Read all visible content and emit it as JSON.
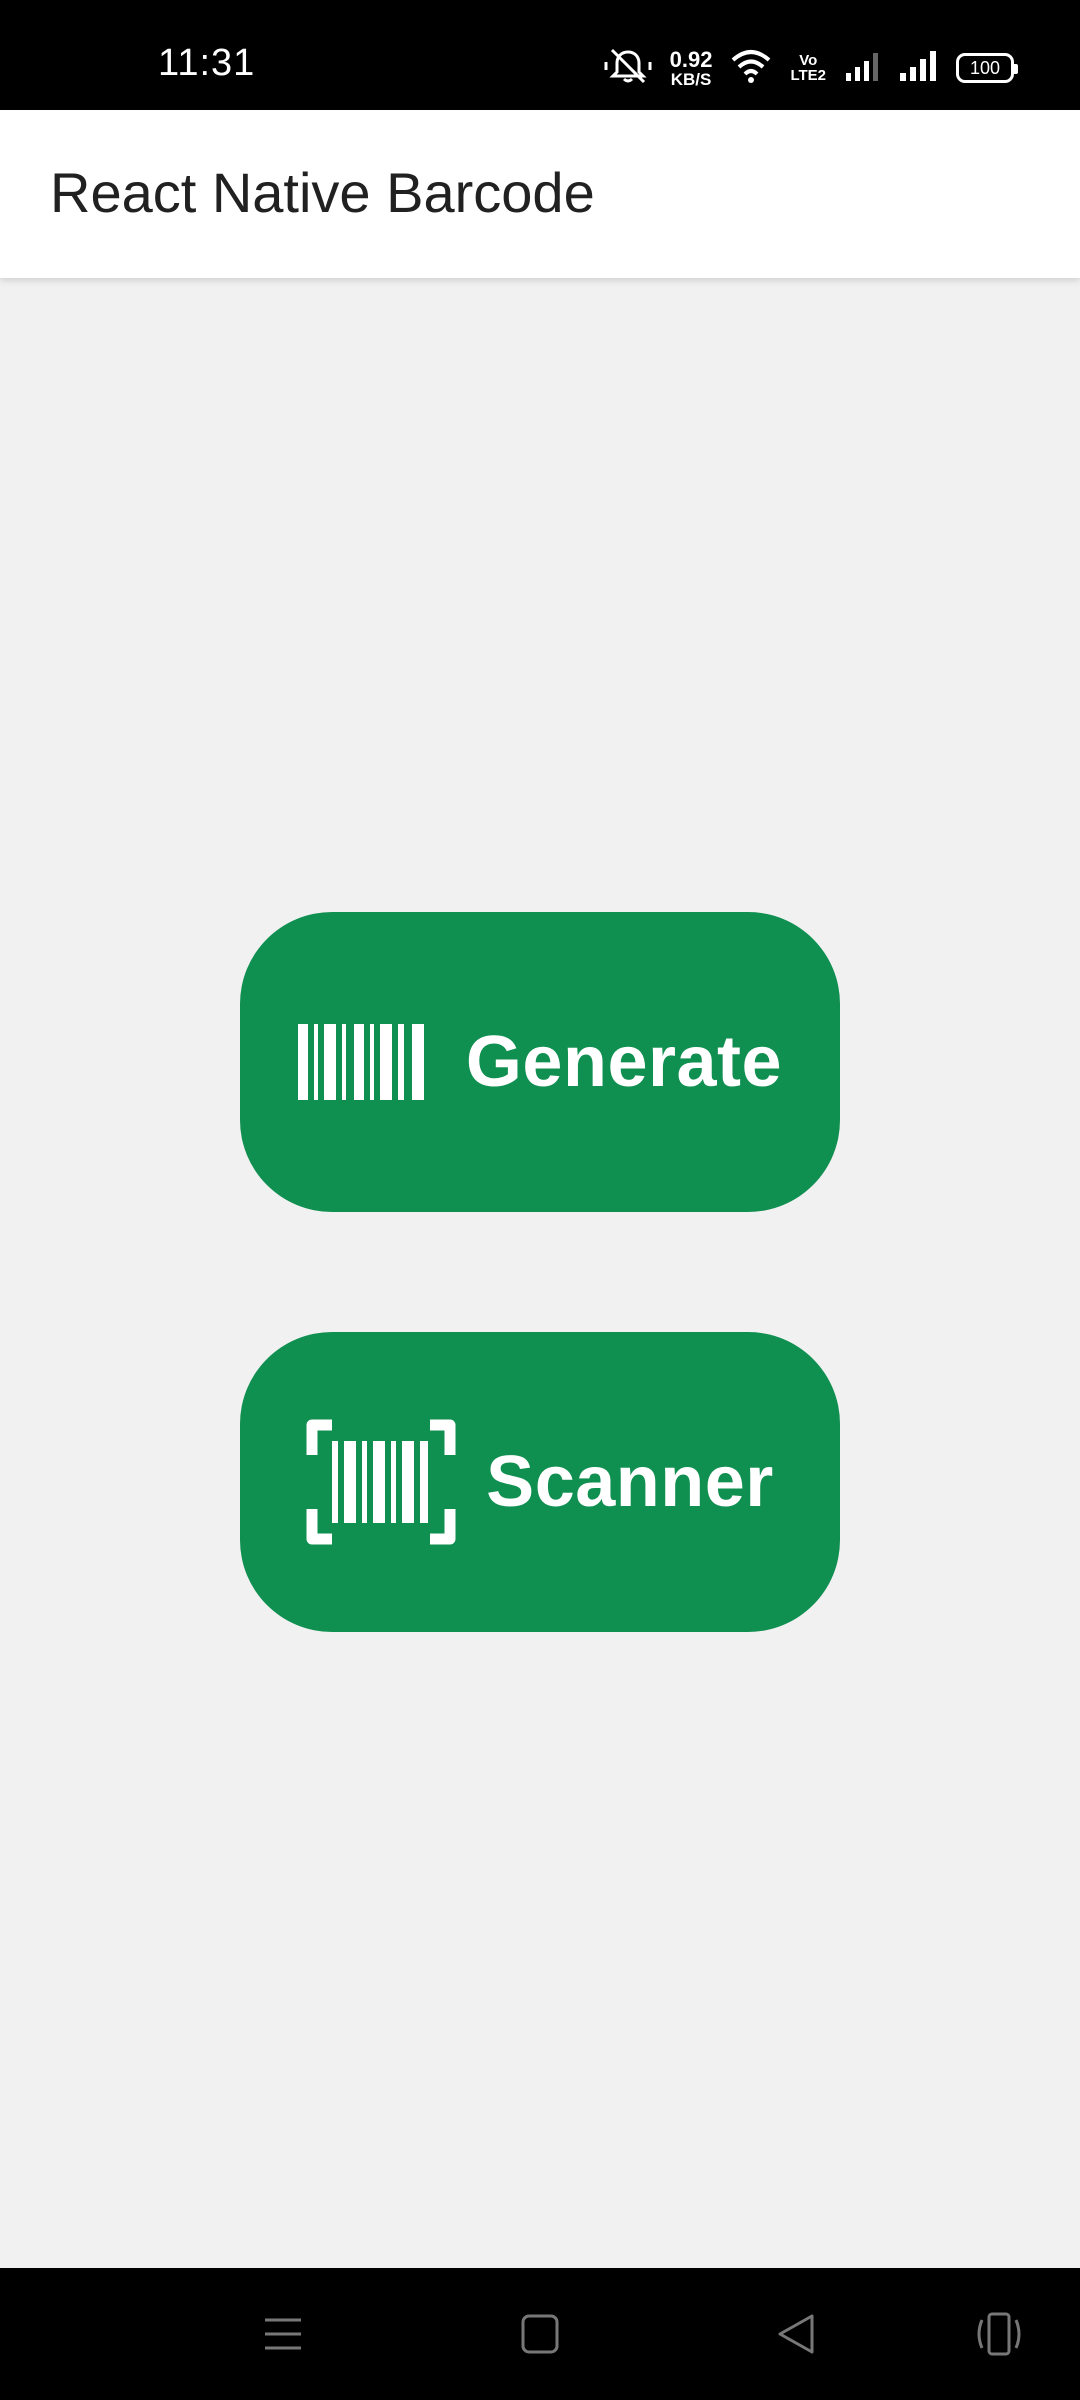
{
  "status_bar": {
    "time": "11:31",
    "net_speed_value": "0.92",
    "net_speed_unit": "KB/S",
    "volte_top": "Vo",
    "volte_bottom": "LTE2",
    "battery": "100"
  },
  "app_bar": {
    "title": "React Native Barcode"
  },
  "buttons": {
    "generate_label": "Generate",
    "scanner_label": "Scanner"
  },
  "icons": {
    "generate": "barcode-icon",
    "scanner": "barcode-scan-icon"
  },
  "colors": {
    "button_green": "#0f8f50",
    "background": "#f1f1f1",
    "app_bar": "#ffffff"
  },
  "nav_bar": {
    "buttons": [
      "menu-icon",
      "home-icon",
      "back-icon",
      "screen-rotate-icon"
    ]
  }
}
